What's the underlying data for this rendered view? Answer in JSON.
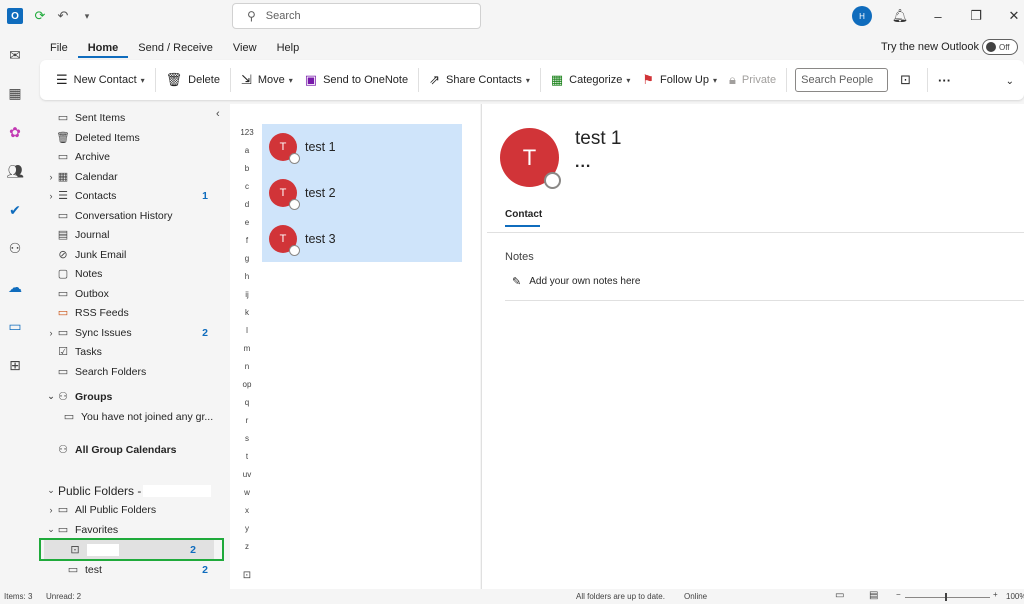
{
  "titlebar": {
    "search_placeholder": "Search",
    "avatar_initial": "H"
  },
  "menu": {
    "tabs": [
      "File",
      "Home",
      "Send / Receive",
      "View",
      "Help"
    ],
    "active_tab": "Home",
    "try_new_label": "Try the new Outlook",
    "toggle_label": "Off"
  },
  "ribbon": {
    "new_contact": "New Contact",
    "delete": "Delete",
    "move": "Move",
    "onenote": "Send to OneNote",
    "share": "Share Contacts",
    "categorize": "Categorize",
    "follow_up": "Follow Up",
    "private": "Private",
    "search_people_placeholder": "Search People",
    "more": "···"
  },
  "folders": {
    "sent_items": "Sent Items",
    "deleted_items": "Deleted Items",
    "archive": "Archive",
    "calendar": "Calendar",
    "contacts": "Contacts",
    "contacts_count": "1",
    "conversation_history": "Conversation History",
    "journal": "Journal",
    "junk_email": "Junk Email",
    "notes": "Notes",
    "outbox": "Outbox",
    "rss_feeds": "RSS Feeds",
    "sync_issues": "Sync Issues",
    "sync_issues_count": "2",
    "tasks": "Tasks",
    "search_folders": "Search Folders",
    "groups": "Groups",
    "groups_note": "You have not joined any gr...",
    "all_group_calendars": "All Group Calendars",
    "public_folders": "Public Folders -",
    "all_public_folders": "All Public Folders",
    "favorites": "Favorites",
    "favorite_count": "2",
    "test_folder": "test",
    "test_folder_count": "2"
  },
  "alphabet": [
    "123",
    "a",
    "b",
    "c",
    "d",
    "e",
    "f",
    "g",
    "h",
    "ij",
    "k",
    "l",
    "m",
    "n",
    "op",
    "q",
    "r",
    "s",
    "t",
    "uv",
    "w",
    "x",
    "y",
    "z"
  ],
  "contacts": [
    {
      "initial": "T",
      "name": "test 1"
    },
    {
      "initial": "T",
      "name": "test 2"
    },
    {
      "initial": "T",
      "name": "test 3"
    }
  ],
  "reading": {
    "initial": "T",
    "name": "test 1",
    "more": "...",
    "tab": "Contact",
    "notes_label": "Notes",
    "add_note": "Add your own notes here"
  },
  "status": {
    "items": "Items: 3",
    "unread": "Unread: 2",
    "sync": "All folders are up to date.",
    "online": "Online",
    "zoom": "100%"
  },
  "colors": {
    "accent": "#0f6cbd",
    "avatar_red": "#d13438",
    "selection_blue": "#cfe4fa",
    "highlight_green": "#1faa3b"
  }
}
